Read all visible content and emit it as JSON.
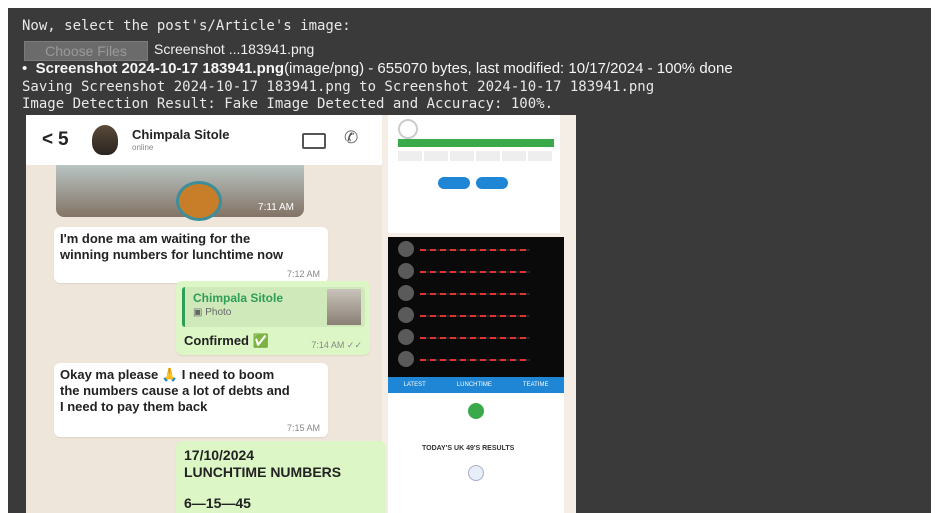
{
  "output": {
    "prompt_line": "Now, select the post's/Article's image:",
    "choose_files_label": "Choose Files",
    "chosen_file": "Screenshot ...183941.png",
    "file_detail": {
      "name": "Screenshot 2024-10-17 183941.png",
      "rest": "(image/png) - 655070 bytes, last modified: 10/17/2024 - 100% done"
    },
    "saving_line": "Saving Screenshot 2024-10-17 183941.png to Screenshot 2024-10-17 183941.png",
    "result_line": "Image Detection Result: Fake Image Detected and Accuracy: 100%."
  },
  "screenshot": {
    "header": {
      "back_count": "5",
      "contact_name": "Chimpala Sitole",
      "contact_status": "online"
    },
    "photo_time": "7:11 AM",
    "messages": [
      {
        "text": "I'm done ma am waiting for the winning numbers for lunchtime now",
        "time": "7:12 AM"
      },
      {
        "quoted_name": "Chimpala Sitole",
        "quoted_type": "Photo",
        "text": "Confirmed ✅",
        "time": "7:14 AM ✓✓"
      },
      {
        "text": "Okay ma please 🙏 I need to boom the numbers cause a lot of debts and I need to pay them back",
        "time": "7:15 AM"
      },
      {
        "date": "17/10/2024",
        "title": "LUNCHTIME NUMBERS",
        "numbers": "6—15—45"
      }
    ],
    "right_panel": {
      "tabs": [
        "LATEST",
        "LUNCHTIME",
        "TEATIME"
      ],
      "results_title": "TODAY'S UK 49'S RESULTS"
    }
  },
  "colors": {
    "panel_bg": "#3a3a3a",
    "chat_bg": "#efe6db",
    "outgoing_bubble": "#dcf6c6",
    "accent_blue": "#1f86d6"
  }
}
